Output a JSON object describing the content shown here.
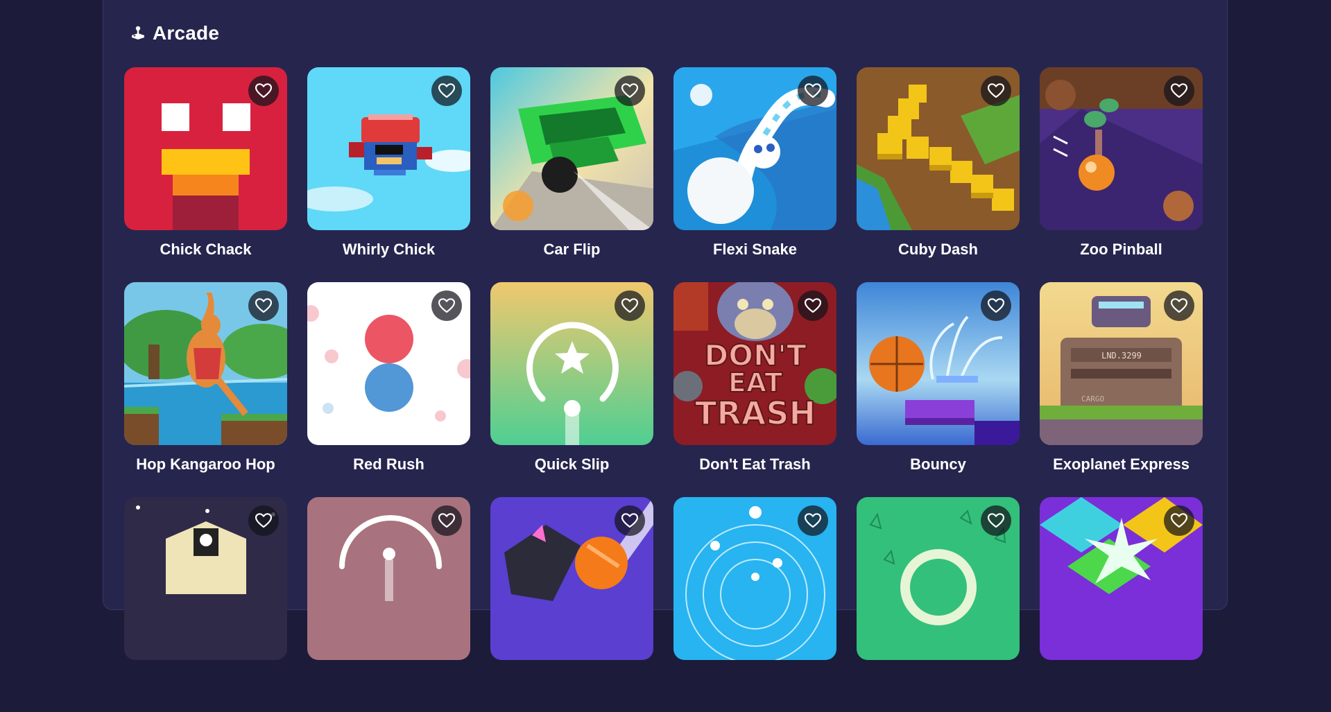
{
  "section": {
    "title": "Arcade",
    "icon": "joystick-icon"
  },
  "games": [
    {
      "name": "Chick Chack",
      "favorite_icon": "heart-outline-icon"
    },
    {
      "name": "Whirly Chick",
      "favorite_icon": "heart-outline-icon"
    },
    {
      "name": "Car Flip",
      "favorite_icon": "heart-outline-icon"
    },
    {
      "name": "Flexi Snake",
      "favorite_icon": "heart-outline-icon"
    },
    {
      "name": "Cuby Dash",
      "favorite_icon": "heart-outline-icon"
    },
    {
      "name": "Zoo Pinball",
      "favorite_icon": "heart-outline-icon"
    },
    {
      "name": "Hop Kangaroo Hop",
      "favorite_icon": "heart-outline-icon"
    },
    {
      "name": "Red Rush",
      "favorite_icon": "heart-outline-icon"
    },
    {
      "name": "Quick Slip",
      "favorite_icon": "heart-outline-icon"
    },
    {
      "name": "Don't Eat Trash",
      "favorite_icon": "heart-outline-icon",
      "art_text": [
        "DON'T",
        "EAT",
        "TRASH"
      ]
    },
    {
      "name": "Bouncy",
      "favorite_icon": "heart-outline-icon"
    },
    {
      "name": "Exoplanet Express",
      "favorite_icon": "heart-outline-icon",
      "art_text": [
        "LND.3299",
        "CARGO"
      ]
    },
    {
      "name": "",
      "favorite_icon": "heart-outline-icon"
    },
    {
      "name": "",
      "favorite_icon": "heart-outline-icon"
    },
    {
      "name": "",
      "favorite_icon": "heart-outline-icon"
    },
    {
      "name": "",
      "favorite_icon": "heart-outline-icon"
    },
    {
      "name": "",
      "favorite_icon": "heart-outline-icon"
    },
    {
      "name": "",
      "favorite_icon": "heart-outline-icon"
    }
  ],
  "colors": {
    "background": "#1c1b3a",
    "panel": "#26254e",
    "text": "#ffffff"
  }
}
